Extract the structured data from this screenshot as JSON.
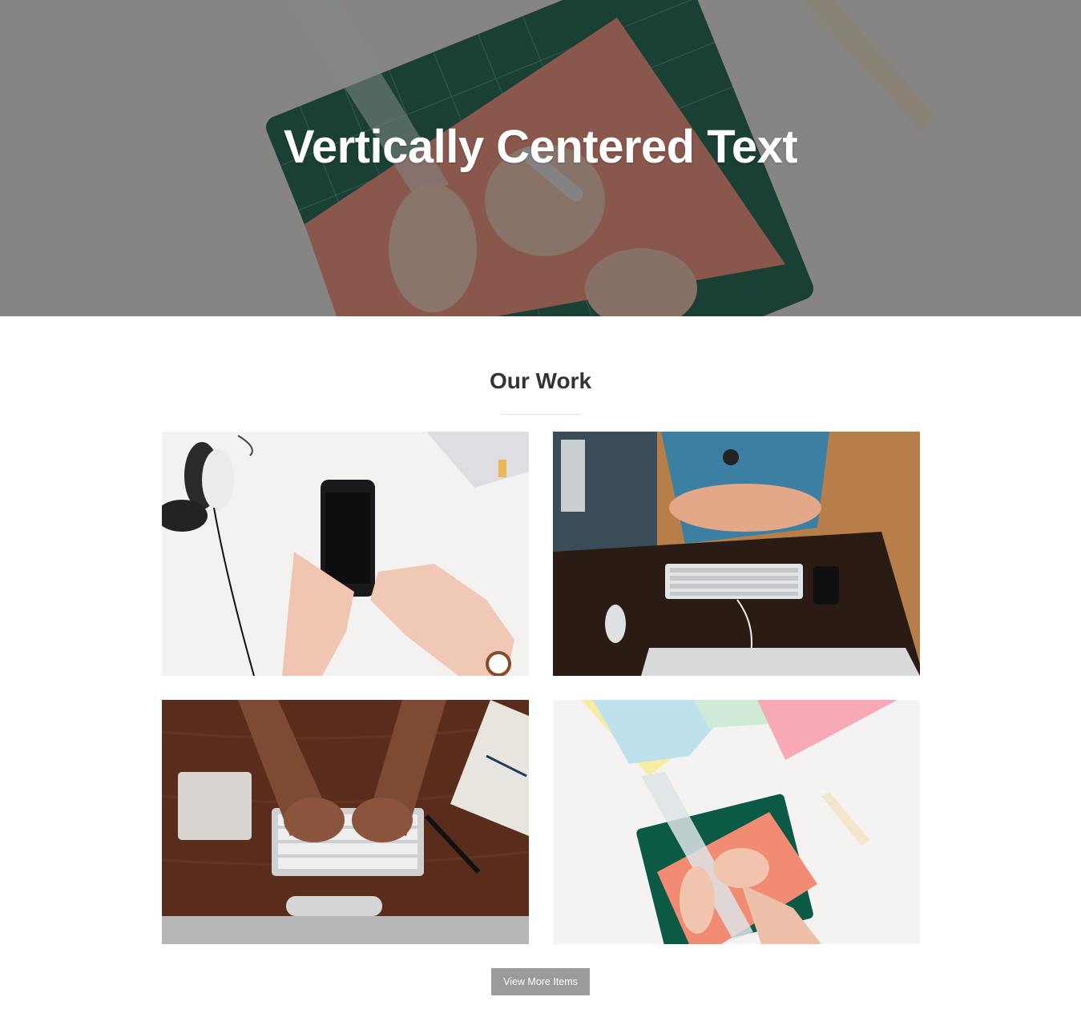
{
  "hero": {
    "title": "Vertically Centered Text"
  },
  "work": {
    "title": "Our Work",
    "tiles": [
      {
        "icon": "phone-desk-photo"
      },
      {
        "icon": "keyboard-desk-photo"
      },
      {
        "icon": "typing-hands-photo"
      },
      {
        "icon": "cutting-mat-photo"
      }
    ],
    "more_label": "View More Items"
  },
  "colors": {
    "overlay": "#282828",
    "button": "#9b9b9b",
    "rule": "#e4e4e4",
    "mat_green": "#0c5c46",
    "paper_coral": "#f08a73"
  }
}
